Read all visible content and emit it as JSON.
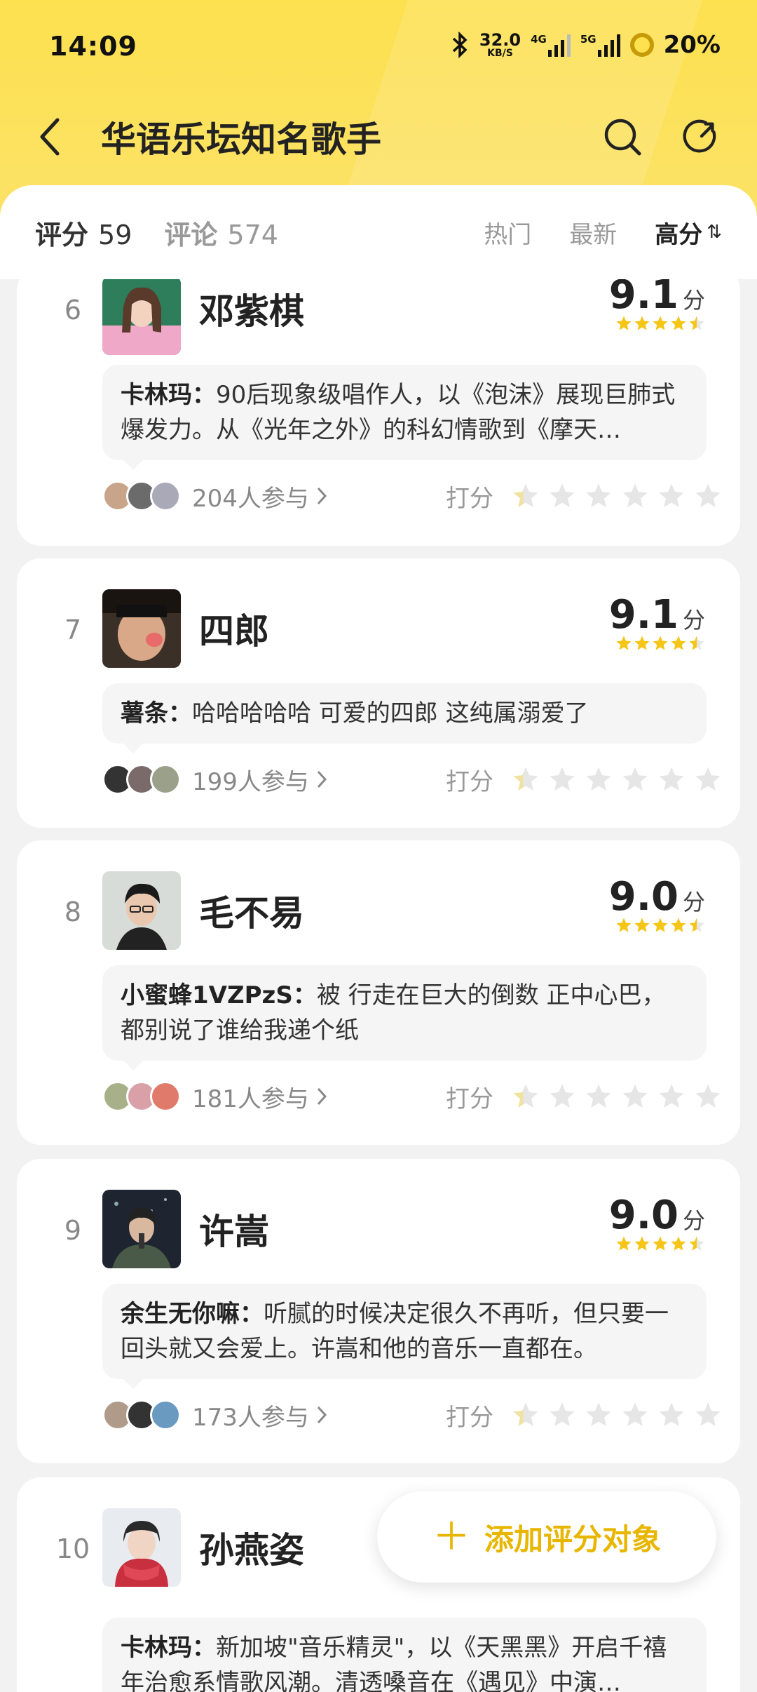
{
  "status": {
    "time": "14:09",
    "speed_value": "32.0",
    "speed_unit": "KB/S",
    "net1": "4G",
    "net2": "5G",
    "battery": "20%"
  },
  "nav": {
    "title": "华语乐坛知名歌手"
  },
  "tabs": {
    "rating_label": "评分",
    "rating_count": "59",
    "comment_label": "评论",
    "comment_count": "574",
    "sort_hot": "热门",
    "sort_new": "最新",
    "sort_high": "高分"
  },
  "items": [
    {
      "rank": "6",
      "name": "邓紫棋",
      "score": "9.1",
      "score_unit": "分",
      "stars": 4.5,
      "comment_author": "卡林玛：",
      "comment_text": "90后现象级唱作人，以《泡沫》展现巨肺式爆发力。从《光年之外》的科幻情歌到《摩天…",
      "participants": "204人参与",
      "rate_label": "打分",
      "colors": [
        "#c8a58a",
        "#6b6b6b",
        "#a9a9b8"
      ]
    },
    {
      "rank": "7",
      "name": "四郎",
      "score": "9.1",
      "score_unit": "分",
      "stars": 4.5,
      "comment_author": "薯条：",
      "comment_text": "哈哈哈哈哈 可爱的四郎 这纯属溺爱了",
      "participants": "199人参与",
      "rate_label": "打分",
      "colors": [
        "#333333",
        "#7a6a6a",
        "#9aa08a"
      ]
    },
    {
      "rank": "8",
      "name": "毛不易",
      "score": "9.0",
      "score_unit": "分",
      "stars": 4.5,
      "comment_author": "小蜜蜂1VZPzS：",
      "comment_text": "被 行走在巨大的倒数 正中心巴，都别说了谁给我递个纸",
      "participants": "181人参与",
      "rate_label": "打分",
      "colors": [
        "#a8b08a",
        "#d9a0a8",
        "#e07a6a"
      ]
    },
    {
      "rank": "9",
      "name": "许嵩",
      "score": "9.0",
      "score_unit": "分",
      "stars": 4.5,
      "comment_author": "余生无你嘛：",
      "comment_text": "听腻的时候决定很久不再听，但只要一回头就又会爱上。许嵩和他的音乐一直都在。",
      "participants": "173人参与",
      "rate_label": "打分",
      "colors": [
        "#b09a8a",
        "#333333",
        "#6a9ac0"
      ]
    },
    {
      "rank": "10",
      "name": "孙燕姿",
      "score": "",
      "score_unit": "",
      "stars": 0,
      "comment_author": "卡林玛：",
      "comment_text": "新加坡\"音乐精灵\"，以《天黑黑》开启千禧年治愈系情歌风潮。清透嗓音在《遇见》中演…",
      "participants": "",
      "rate_label": "",
      "colors": []
    }
  ],
  "fab": {
    "label": "添加评分对象"
  },
  "theme": {
    "accent": "#e8b600",
    "star": "#f5c518",
    "header": "#fde14f"
  }
}
